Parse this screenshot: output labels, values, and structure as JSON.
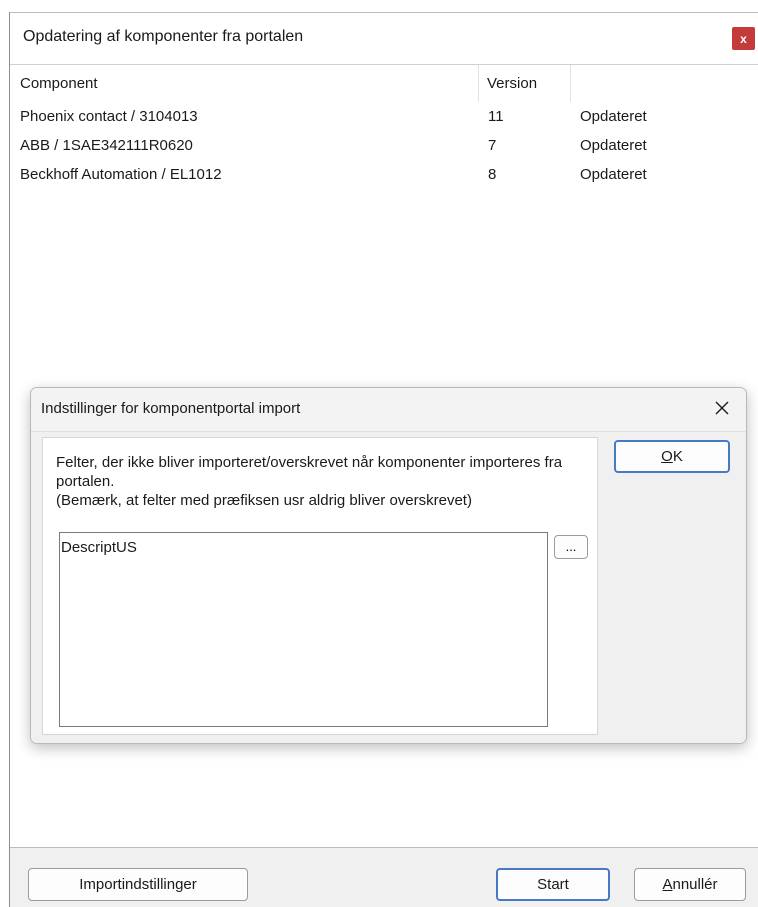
{
  "window": {
    "title": "Opdatering af komponenter fra portalen",
    "close_glyph": "x"
  },
  "list": {
    "columns": [
      "Component",
      "Version",
      ""
    ],
    "rows": [
      {
        "component": "Phoenix contact / 3104013",
        "version": "11",
        "status": "Opdateret"
      },
      {
        "component": "ABB / 1SAE342111R0620",
        "version": "7",
        "status": "Opdateret"
      },
      {
        "component": "Beckhoff Automation / EL1012",
        "version": "8",
        "status": "Opdateret"
      }
    ]
  },
  "dialog": {
    "title": "Indstillinger for komponentportal import",
    "description_line1": "Felter, der ikke bliver importeret/overskrevet når komponenter importeres fra portalen.",
    "description_line2": "(Bemærk, at felter med præfiksen usr aldrig bliver overskrevet)",
    "fields_value": "DescriptUS",
    "browse_label": "...",
    "ok_label": "OK"
  },
  "buttons": {
    "import_settings": "Importindstillinger",
    "start": "Start",
    "cancel": "Annullér"
  },
  "colors": {
    "close_red": "#c43b3b",
    "focus_blue": "#4a78c8"
  }
}
